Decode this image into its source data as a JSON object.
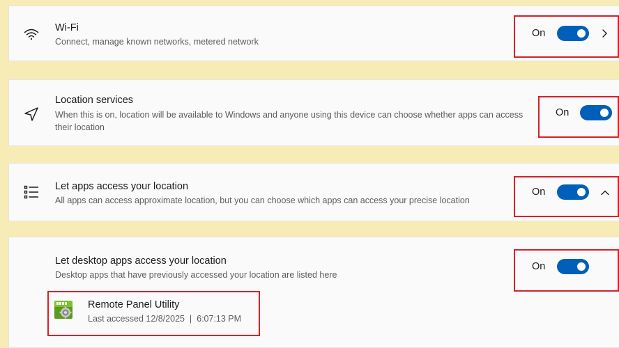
{
  "wifi": {
    "title": "Wi-Fi",
    "description": "Connect, manage known networks, metered network",
    "state_label": "On",
    "enabled": true,
    "icon": "wifi-icon",
    "has_chevron": "chevron-right-icon"
  },
  "location_services": {
    "title": "Location services",
    "description": "When this is on, location will be available to Windows and anyone using this device can choose whether apps can access their location",
    "state_label": "On",
    "enabled": true,
    "icon": "location-arrow-icon"
  },
  "app_location": {
    "title": "Let apps access your location",
    "description": "All apps can access approximate location, but you can choose which apps can access your precise location",
    "state_label": "On",
    "enabled": true,
    "icon": "list-icon",
    "has_chevron": "chevron-up-icon"
  },
  "desktop_apps": {
    "title": "Let desktop apps access your location",
    "description": "Desktop apps that have previously accessed your location are listed here",
    "state_label": "On",
    "enabled": true,
    "apps": [
      {
        "name": "Remote Panel Utility",
        "last_accessed": "Last accessed 12/8/2025  |  6:07:13 PM",
        "icon": "app-gear-icon"
      }
    ]
  },
  "colors": {
    "background": "#f7ecb5",
    "toggle_on": "#005fb8",
    "highlight": "#d6202a"
  }
}
